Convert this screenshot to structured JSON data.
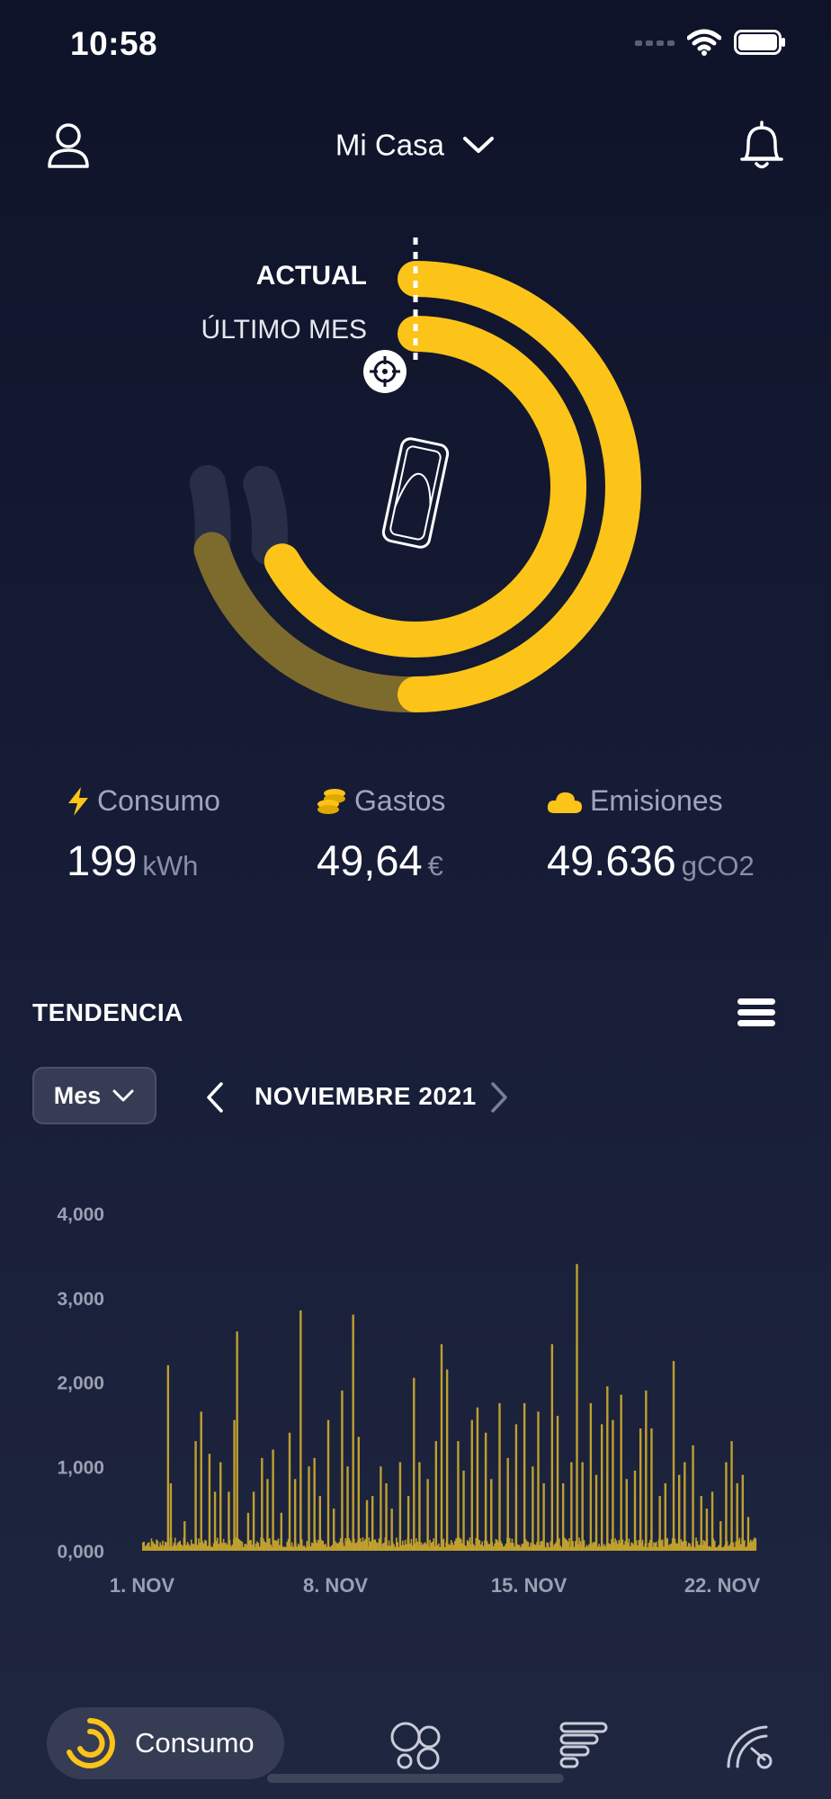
{
  "status_bar": {
    "time": "10:58"
  },
  "header": {
    "title": "Mi Casa"
  },
  "ring": {
    "current_label": "ACTUAL",
    "previous_label": "ÚLTIMO MES",
    "colors": {
      "accent": "#fcc419",
      "previous": "#7d6a2d",
      "track": "#2a3048"
    }
  },
  "stats": [
    {
      "label": "Consumo",
      "value": "199",
      "unit": "kWh",
      "icon": "lightning-icon"
    },
    {
      "label": "Gastos",
      "value": "49,64",
      "unit": "€",
      "icon": "coins-icon"
    },
    {
      "label": "Emisiones",
      "value": "49.636",
      "unit": "gCO2",
      "icon": "cloud-icon"
    }
  ],
  "trend": {
    "title": "TENDENCIA",
    "period_select": "Mes",
    "period": "NOVIEMBRE 2021"
  },
  "chart_data": {
    "type": "bar",
    "color": "#bfa02e",
    "y_ticks": [
      "4,000",
      "3,000",
      "2,000",
      "1,000",
      "0,000"
    ],
    "ylim": [
      0,
      4000
    ],
    "x_ticks": [
      {
        "label": "1. NOV",
        "day": 1
      },
      {
        "label": "8. NOV",
        "day": 8
      },
      {
        "label": "15. NOV",
        "day": 15
      },
      {
        "label": "22. NOV",
        "day": 22
      }
    ],
    "x_range_days": [
      1,
      23.2
    ],
    "spikes": [
      {
        "day": 1.9,
        "value": 2200
      },
      {
        "day": 2.0,
        "value": 800
      },
      {
        "day": 2.5,
        "value": 350
      },
      {
        "day": 2.9,
        "value": 1300
      },
      {
        "day": 3.1,
        "value": 1650
      },
      {
        "day": 3.4,
        "value": 1150
      },
      {
        "day": 3.6,
        "value": 700
      },
      {
        "day": 3.8,
        "value": 1050
      },
      {
        "day": 4.1,
        "value": 700
      },
      {
        "day": 4.3,
        "value": 1550
      },
      {
        "day": 4.4,
        "value": 2600
      },
      {
        "day": 4.8,
        "value": 450
      },
      {
        "day": 5.0,
        "value": 700
      },
      {
        "day": 5.3,
        "value": 1100
      },
      {
        "day": 5.5,
        "value": 850
      },
      {
        "day": 5.7,
        "value": 1200
      },
      {
        "day": 6.0,
        "value": 450
      },
      {
        "day": 6.3,
        "value": 1400
      },
      {
        "day": 6.5,
        "value": 850
      },
      {
        "day": 6.7,
        "value": 2850
      },
      {
        "day": 7.0,
        "value": 1000
      },
      {
        "day": 7.2,
        "value": 1100
      },
      {
        "day": 7.4,
        "value": 650
      },
      {
        "day": 7.7,
        "value": 1550
      },
      {
        "day": 7.9,
        "value": 500
      },
      {
        "day": 8.2,
        "value": 1900
      },
      {
        "day": 8.4,
        "value": 1000
      },
      {
        "day": 8.6,
        "value": 2800
      },
      {
        "day": 8.8,
        "value": 1350
      },
      {
        "day": 9.1,
        "value": 600
      },
      {
        "day": 9.3,
        "value": 650
      },
      {
        "day": 9.6,
        "value": 1000
      },
      {
        "day": 9.8,
        "value": 800
      },
      {
        "day": 10.0,
        "value": 500
      },
      {
        "day": 10.3,
        "value": 1050
      },
      {
        "day": 10.6,
        "value": 650
      },
      {
        "day": 10.8,
        "value": 2050
      },
      {
        "day": 11.0,
        "value": 1050
      },
      {
        "day": 11.3,
        "value": 850
      },
      {
        "day": 11.6,
        "value": 1300
      },
      {
        "day": 11.8,
        "value": 2450
      },
      {
        "day": 12.0,
        "value": 2150
      },
      {
        "day": 12.4,
        "value": 1300
      },
      {
        "day": 12.6,
        "value": 950
      },
      {
        "day": 12.9,
        "value": 1550
      },
      {
        "day": 13.1,
        "value": 1700
      },
      {
        "day": 13.4,
        "value": 1400
      },
      {
        "day": 13.6,
        "value": 850
      },
      {
        "day": 13.9,
        "value": 1750
      },
      {
        "day": 14.2,
        "value": 1100
      },
      {
        "day": 14.5,
        "value": 1500
      },
      {
        "day": 14.8,
        "value": 1750
      },
      {
        "day": 15.1,
        "value": 1000
      },
      {
        "day": 15.3,
        "value": 1650
      },
      {
        "day": 15.5,
        "value": 800
      },
      {
        "day": 15.8,
        "value": 2450
      },
      {
        "day": 16.0,
        "value": 1600
      },
      {
        "day": 16.2,
        "value": 800
      },
      {
        "day": 16.5,
        "value": 1050
      },
      {
        "day": 16.7,
        "value": 3400
      },
      {
        "day": 16.9,
        "value": 1050
      },
      {
        "day": 17.2,
        "value": 1750
      },
      {
        "day": 17.4,
        "value": 900
      },
      {
        "day": 17.6,
        "value": 1500
      },
      {
        "day": 17.8,
        "value": 1950
      },
      {
        "day": 18.0,
        "value": 1550
      },
      {
        "day": 18.3,
        "value": 1850
      },
      {
        "day": 18.5,
        "value": 850
      },
      {
        "day": 18.8,
        "value": 950
      },
      {
        "day": 19.0,
        "value": 1450
      },
      {
        "day": 19.2,
        "value": 1900
      },
      {
        "day": 19.4,
        "value": 1450
      },
      {
        "day": 19.7,
        "value": 650
      },
      {
        "day": 19.9,
        "value": 800
      },
      {
        "day": 20.2,
        "value": 2250
      },
      {
        "day": 20.4,
        "value": 900
      },
      {
        "day": 20.6,
        "value": 1050
      },
      {
        "day": 20.9,
        "value": 1250
      },
      {
        "day": 21.2,
        "value": 650
      },
      {
        "day": 21.4,
        "value": 500
      },
      {
        "day": 21.6,
        "value": 700
      },
      {
        "day": 21.9,
        "value": 350
      },
      {
        "day": 22.1,
        "value": 1050
      },
      {
        "day": 22.3,
        "value": 1300
      },
      {
        "day": 22.5,
        "value": 800
      },
      {
        "day": 22.7,
        "value": 900
      },
      {
        "day": 22.9,
        "value": 400
      }
    ]
  },
  "bottom_nav": {
    "active_label": "Consumo",
    "items": [
      "consumo-icon",
      "bubbles-icon",
      "bars-icon",
      "gauge-icon"
    ]
  }
}
